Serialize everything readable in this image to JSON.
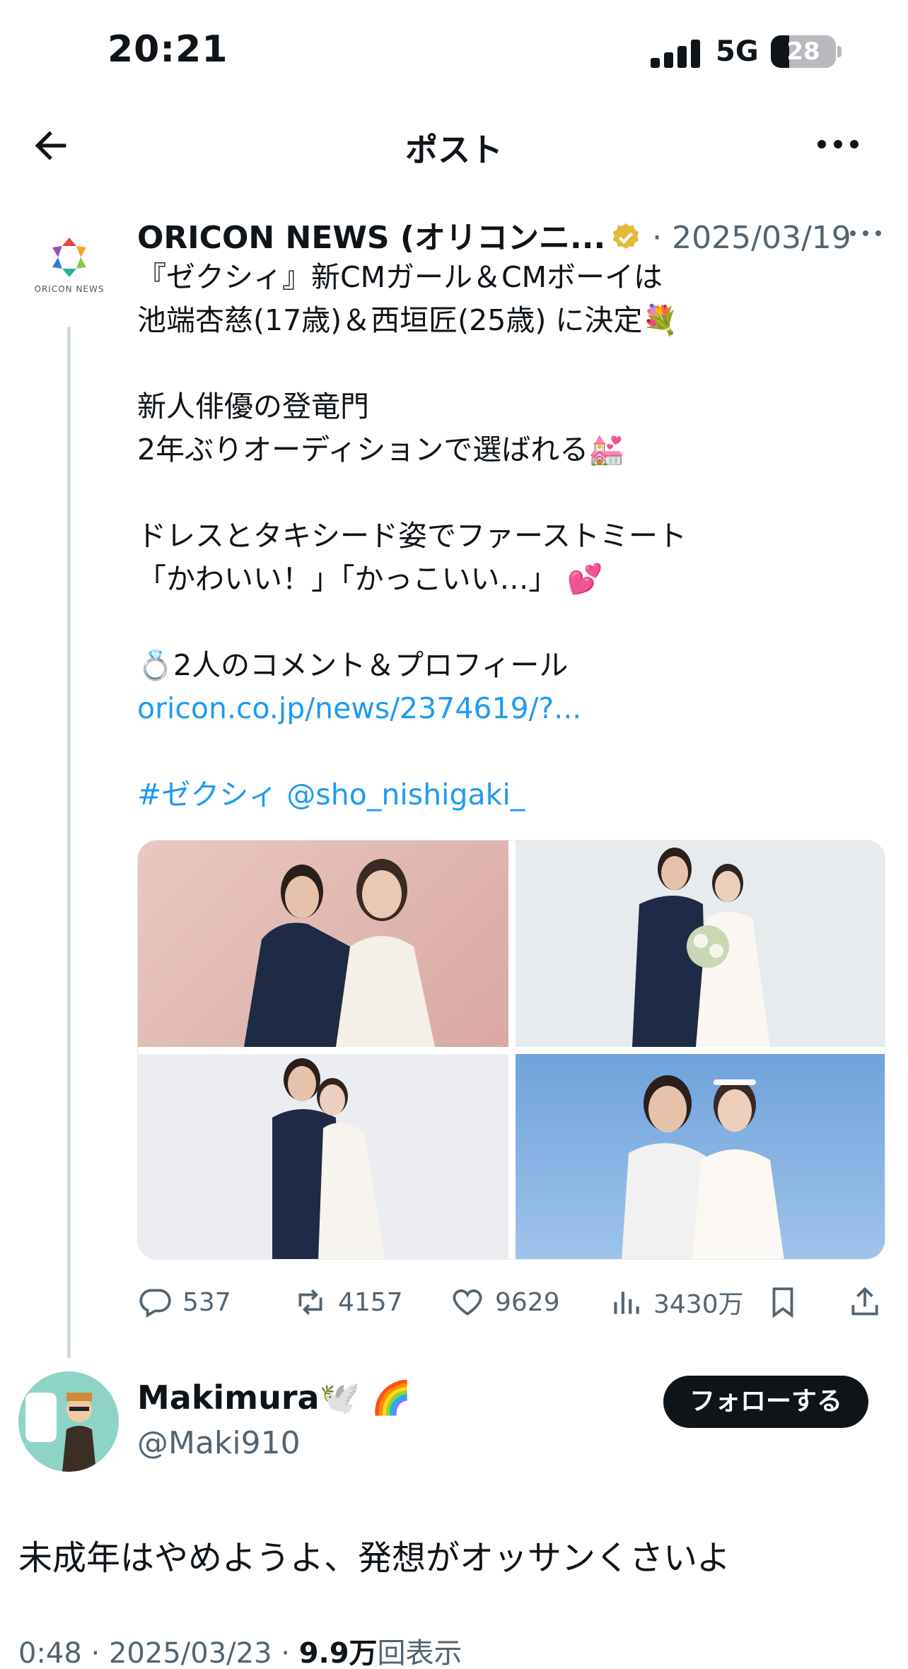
{
  "status_bar": {
    "time": "20:21",
    "network": "5G",
    "battery": "28"
  },
  "header": {
    "title": "ポスト"
  },
  "tweet": {
    "author_name": "ORICON NEWS (オリコンニ...",
    "avatar_text": "ORICON NEWS",
    "separator": "·",
    "date": "2025/03/19",
    "lines": [
      "『ゼクシィ』新CMガール＆CMボーイは",
      "池端杏慈(17歳)＆西垣匠(25歳) に決定💐",
      "",
      "新人俳優の登竜門",
      "2年ぶりオーディションで選ばれる💒",
      "",
      "ドレスとタキシード姿でファーストミート",
      "「かわいい！」「かっこいい…」 💕",
      "",
      "💍2人のコメント＆プロフィール"
    ],
    "link": "oricon.co.jp/news/2374619/?...",
    "hashtag": "#ゼクシィ",
    "mention": "@sho_nishigaki_",
    "stats": {
      "replies": "537",
      "retweets": "4157",
      "likes": "9629",
      "views": "3430万"
    }
  },
  "reply": {
    "name": "Makimura🕊️ 🌈",
    "handle": "@Maki910",
    "follow_label": "フォローする",
    "text": "未成年はやめようよ、発想がオッサンくさいよ",
    "time": "0:48",
    "date": "2025/03/23",
    "views_count": "9.9万",
    "views_label": "回表示"
  },
  "colors": {
    "accent": "#1d9bf0",
    "text": "#0f1419",
    "muted": "#536471",
    "verified_gold": "#e2b93b"
  },
  "icons": [
    "back-arrow-icon",
    "more-icon",
    "verified-gold-icon",
    "reply-icon",
    "retweet-icon",
    "like-icon",
    "views-icon",
    "bookmark-icon",
    "share-icon"
  ]
}
